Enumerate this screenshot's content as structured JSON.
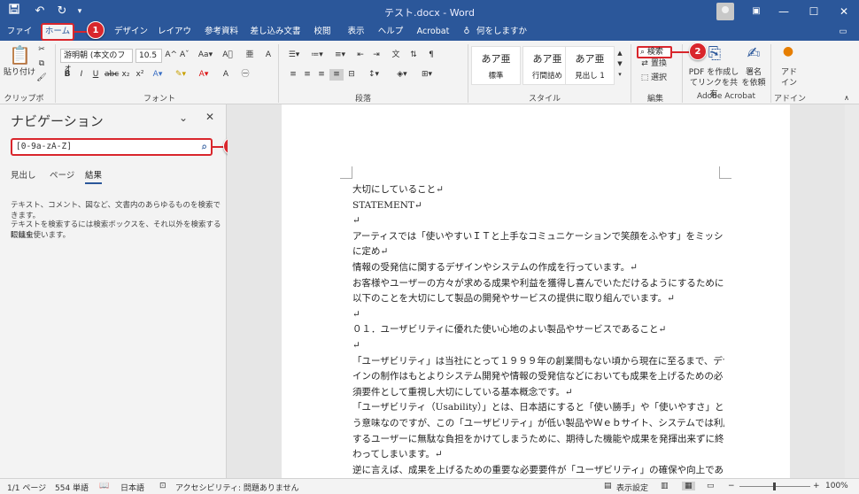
{
  "window": {
    "title": "テスト.docx - Word",
    "controls": [
      "—",
      "☐",
      "✕"
    ]
  },
  "menu": {
    "tabs": [
      "ファイル",
      "ホーム",
      "挿入",
      "デザイン",
      "レイアウト",
      "参考資料",
      "差し込み文書",
      "校閲",
      "表示",
      "ヘルプ",
      "Acrobat"
    ],
    "tellme": "何をしますか"
  },
  "ribbon": {
    "clipboard": {
      "paste": "貼り付け",
      "label": "クリップボード"
    },
    "font": {
      "name": "游明朝 (本文のフォ",
      "size": "10.5",
      "label": "フォント"
    },
    "paragraph": {
      "label": "段落"
    },
    "styles": {
      "items": [
        {
          "sample": "あア亜",
          "name": "標準"
        },
        {
          "sample": "あア亜",
          "name": "行間詰め"
        },
        {
          "sample": "あア亜",
          "name": "見出し 1"
        }
      ],
      "label": "スタイル"
    },
    "editing": {
      "find": "検索",
      "replace": "置換",
      "select": "選択",
      "label": "編集"
    },
    "acrobat": {
      "pdf1": "PDF を作成し",
      "pdf2": "てリンクを共有",
      "sign1": "署名",
      "sign2": "を依頼",
      "label": "Adobe Acrobat"
    },
    "addin": {
      "name1": "アド",
      "name2": "イン",
      "label": "アドイン"
    }
  },
  "navigation": {
    "title": "ナビゲーション",
    "search_value": "[0-9a-zA-Z]",
    "tabs": [
      "見出し",
      "ページ",
      "結果"
    ],
    "message1": "テキスト、コメント、図など、文書内のあらゆるものを検索できます。",
    "message2a": "テキストを検索するには検索ボックスを、それ以外を検索するには虫",
    "message2b": "眼鏡を使います。"
  },
  "document": {
    "lines": [
      "大切にしていること↵",
      "STATEMENT↵",
      "↵",
      "アーティスでは「使いやすいＩＴと上手なコミュニケーションで笑顔をふやす」をミッション",
      "に定め↵",
      "情報の受発信に関するデザインやシステムの作成を行っています。↵",
      "お客様やユーザーの方々が求める成果や利益を獲得し喜んでいただけるようにするために↵",
      "以下のことを大切にして製品の開発やサービスの提供に取り組んでいます。↵",
      "↵",
      "０１．ユーザビリティに優れた使い心地のよい製品やサービスであること↵",
      "↵",
      "「ユーザビリティ」は当社にとって１９９９年の創業間もない頃から現在に至るまで、デザ",
      "インの制作はもとよりシステム開発や情報の受発信などにおいても成果を上げるための必",
      "須要件として重視し大切にしている基本概念です。↵",
      "「ユーザビリティ（Usability）」とは、日本語にすると「使い勝手」や「使いやすさ」とい",
      "う意味なのですが、この「ユーザビリティ」が低い製品やＷｅｂサイト、システムでは利用",
      "するユーザーに無駄な負担をかけてしまうために、期待した機能や成果を発揮出来ずに終",
      "わってしまいます。↵",
      "逆に言えば、成果を上げるための重要な必要要件が「ユーザビリティ」の確保や向上である"
    ]
  },
  "status": {
    "page": "1/1 ページ",
    "words": "554 単語",
    "lang": "日本語",
    "accessibility": "アクセシビリティ: 問題ありません",
    "display": "表示設定",
    "zoom": "100%"
  },
  "callouts": [
    "1",
    "2",
    "3"
  ],
  "colors": {
    "brand": "#2b579a",
    "callout": "#d9262c"
  }
}
